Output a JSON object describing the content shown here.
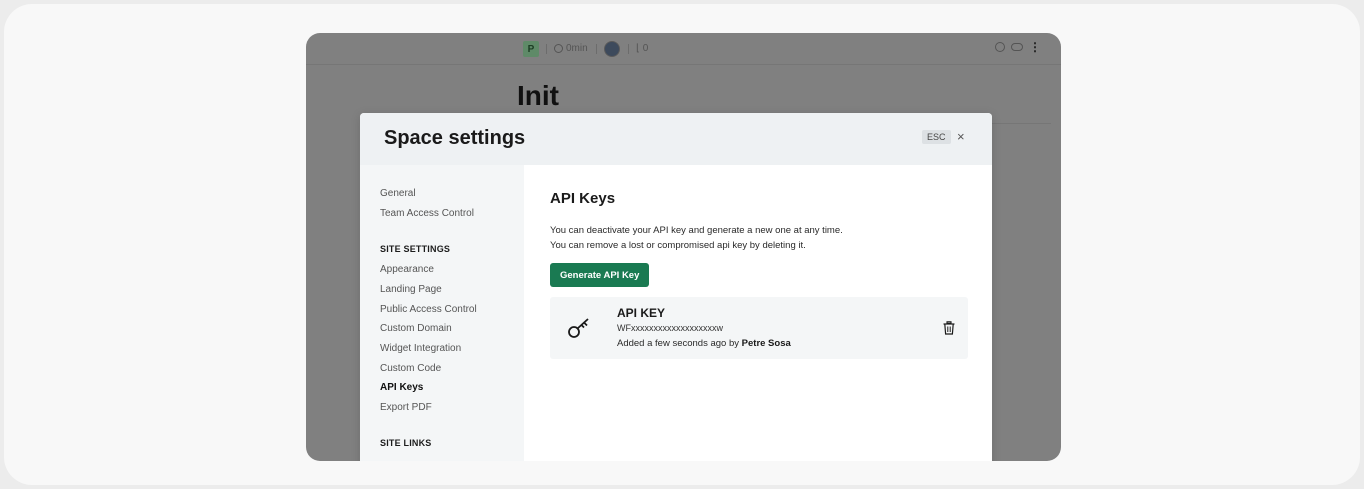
{
  "topbar": {
    "project_initial": "P",
    "time": "0min",
    "count": "0"
  },
  "page": {
    "title": "Init"
  },
  "modal": {
    "title": "Space settings",
    "esc_label": "ESC",
    "close_glyph": "×"
  },
  "sidebar": {
    "items_top": [
      {
        "label": "General"
      },
      {
        "label": "Team Access Control"
      }
    ],
    "section_site_settings": "SITE SETTINGS",
    "items_site": [
      {
        "label": "Appearance"
      },
      {
        "label": "Landing Page"
      },
      {
        "label": "Public Access Control"
      },
      {
        "label": "Custom Domain"
      },
      {
        "label": "Widget Integration"
      },
      {
        "label": "Custom Code"
      },
      {
        "label": "API Keys",
        "active": true
      },
      {
        "label": "Export PDF"
      }
    ],
    "section_site_links": "SITE LINKS"
  },
  "content": {
    "title": "API Keys",
    "desc_line1": "You can deactivate your API key and generate a new one at any time.",
    "desc_line2": "You can remove a lost or compromised api key by deleting it.",
    "generate_button": "Generate API Key",
    "key": {
      "title": "API KEY",
      "value": "WFxxxxxxxxxxxxxxxxxxxw",
      "added_prefix": "Added a few seconds ago by ",
      "added_by": "Petre Sosa"
    }
  },
  "colors": {
    "accent": "#1a7a52",
    "overlay": "#808080",
    "modal_header": "#eef1f3"
  },
  "icons": {
    "clock": "clock-icon",
    "key": "key-icon",
    "trash": "trash-icon",
    "close": "close-icon",
    "more": "more-vertical-icon"
  }
}
